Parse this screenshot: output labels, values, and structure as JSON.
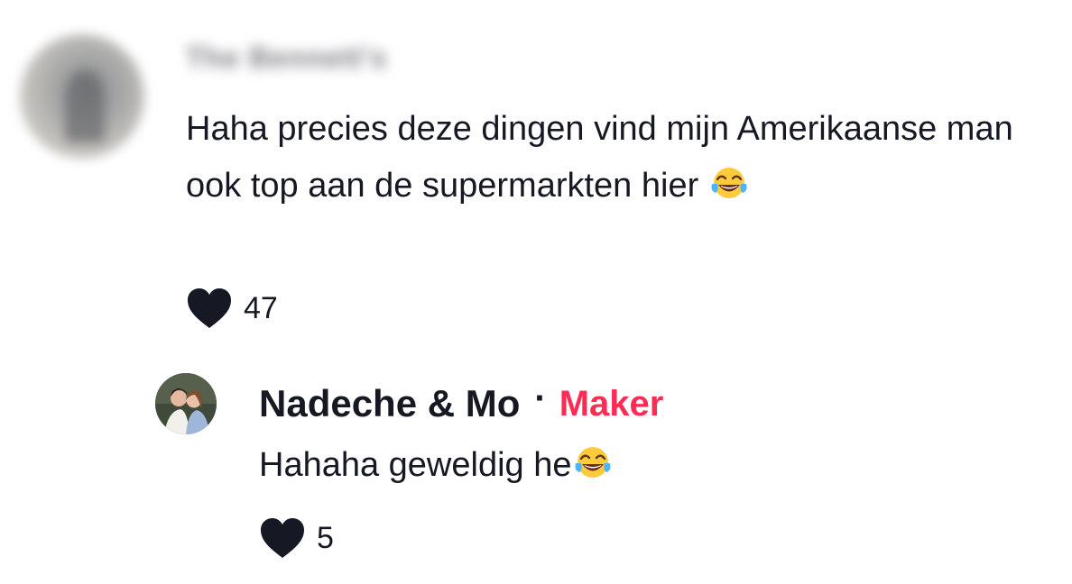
{
  "comment": {
    "author": "The Bennett's",
    "text_before_emoji": "Haha precies deze dingen vind mijn Amerikaanse man ook top aan de supermarkten hier ",
    "emoji_icon": "face-with-tears-of-joy-icon",
    "like_count": "47"
  },
  "reply": {
    "author": "Nadeche & Mo",
    "separator": "·",
    "badge": "Maker",
    "badge_color": "#fe2c55",
    "text_before_emoji": "Hahaha geweldig he",
    "emoji_icon": "face-with-tears-of-joy-icon",
    "like_count": "5"
  },
  "colors": {
    "text": "#161823",
    "heart": "#161823",
    "accent": "#fe2c55"
  }
}
